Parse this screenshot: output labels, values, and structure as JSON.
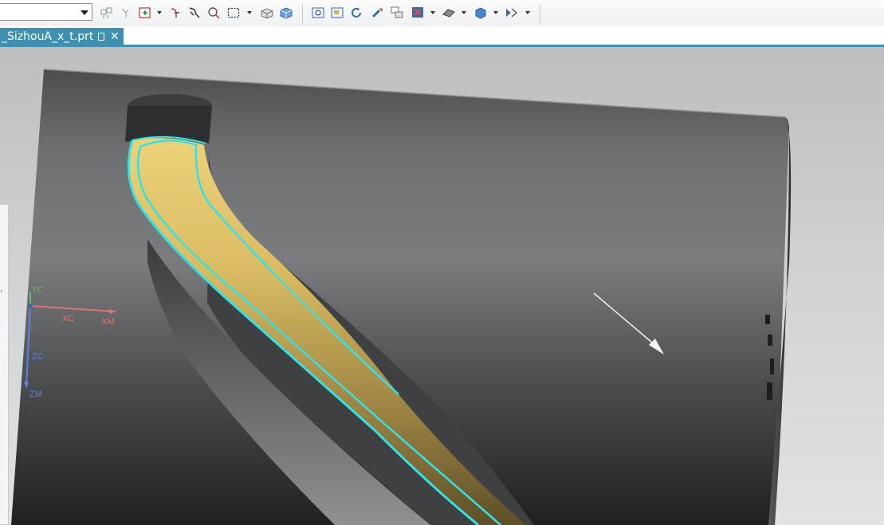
{
  "toolbar": {
    "filter_select_value": "",
    "icons": [
      "snap-point-icon",
      "point-filter-icon",
      "selection-scope-icon",
      "wcs-orient-icon",
      "feature-icon",
      "select-face-icon",
      "rectangle-select-icon",
      "shaded-box-icon",
      "cube-view-icon",
      "fit-view-icon",
      "zoom-window-icon",
      "rotate-view-icon",
      "pan-view-icon",
      "layer-icon",
      "render-style-icon",
      "edge-display-icon",
      "orient-view-icon",
      "section-view-icon"
    ]
  },
  "tab": {
    "label": "_SizhouA_x_t.prt"
  },
  "viewport": {
    "triad": {
      "x_label": "XC",
      "xm_label": "XM",
      "y_label": "YC",
      "z_label": "ZC",
      "zm_label": "ZM"
    },
    "colors": {
      "face_highlight": "#d9b752",
      "edge_highlight": "#2fe3e8",
      "body": "#5c5c5c",
      "background": "#c9cbcd"
    }
  }
}
